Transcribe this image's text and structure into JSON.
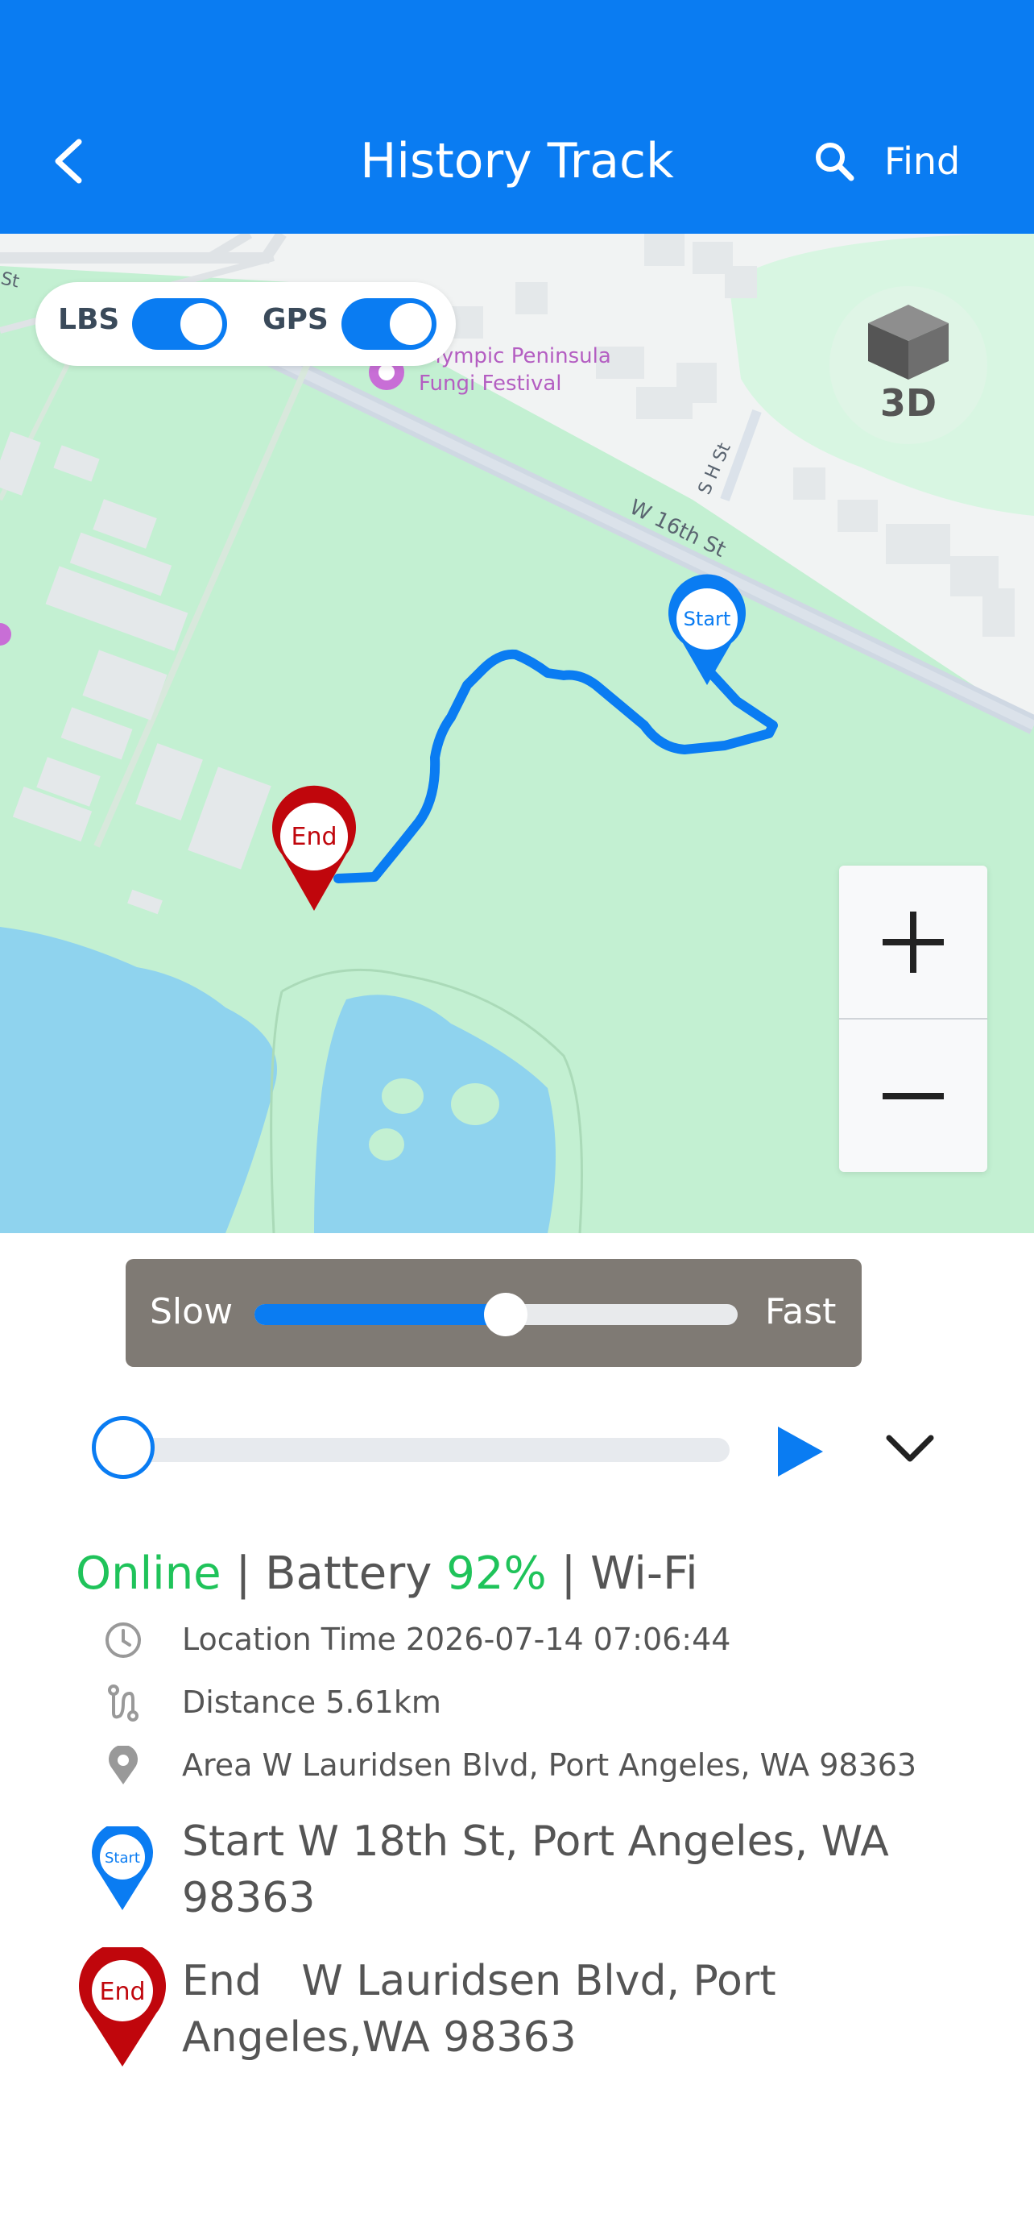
{
  "header": {
    "title": "History Track",
    "find_label": "Find",
    "bg_color": "#0a7cf2"
  },
  "map": {
    "toggles": [
      {
        "label": "LBS",
        "on": true
      },
      {
        "label": "GPS",
        "on": true
      }
    ],
    "btn_3d_label": "3D",
    "labels": {
      "street_w16th": "W 16th St",
      "street_sh": "S H St",
      "street_st": "St",
      "poi_line1": "Olympic Peninsula",
      "poi_line2": "Fungi Festival"
    },
    "pins": {
      "start_label": "Start",
      "end_label": "End"
    },
    "zoom_in_icon": "plus-icon",
    "zoom_out_icon": "minus-icon"
  },
  "speed": {
    "slow_label": "Slow",
    "fast_label": "Fast",
    "level": 0.52
  },
  "playback": {
    "progress": 0.0,
    "play_icon": "play-icon",
    "expand_icon": "chevron-down-icon"
  },
  "status": {
    "online": "Online",
    "sep1": " | Battery ",
    "battery": "92%",
    "sep2": " | ",
    "network": "Wi-Fi"
  },
  "details": {
    "location_time": "Location Time 2026-07-14 07:06:44",
    "distance": "Distance 5.61km",
    "area_label": "Area",
    "area_value": " W Lauridsen Blvd, Port Angeles, WA 98363",
    "start_label": "Start",
    "start_address": " W 18th St, Port Angeles, WA 98363",
    "end_label": "End",
    "end_address": "   W Lauridsen Blvd, Port Angeles,WA 98363"
  },
  "colors": {
    "accent": "#0a7cf2",
    "online_green": "#1fc35a",
    "end_red": "#c0060c",
    "map_green": "#c3f0d2",
    "water": "#8fd3ee"
  }
}
